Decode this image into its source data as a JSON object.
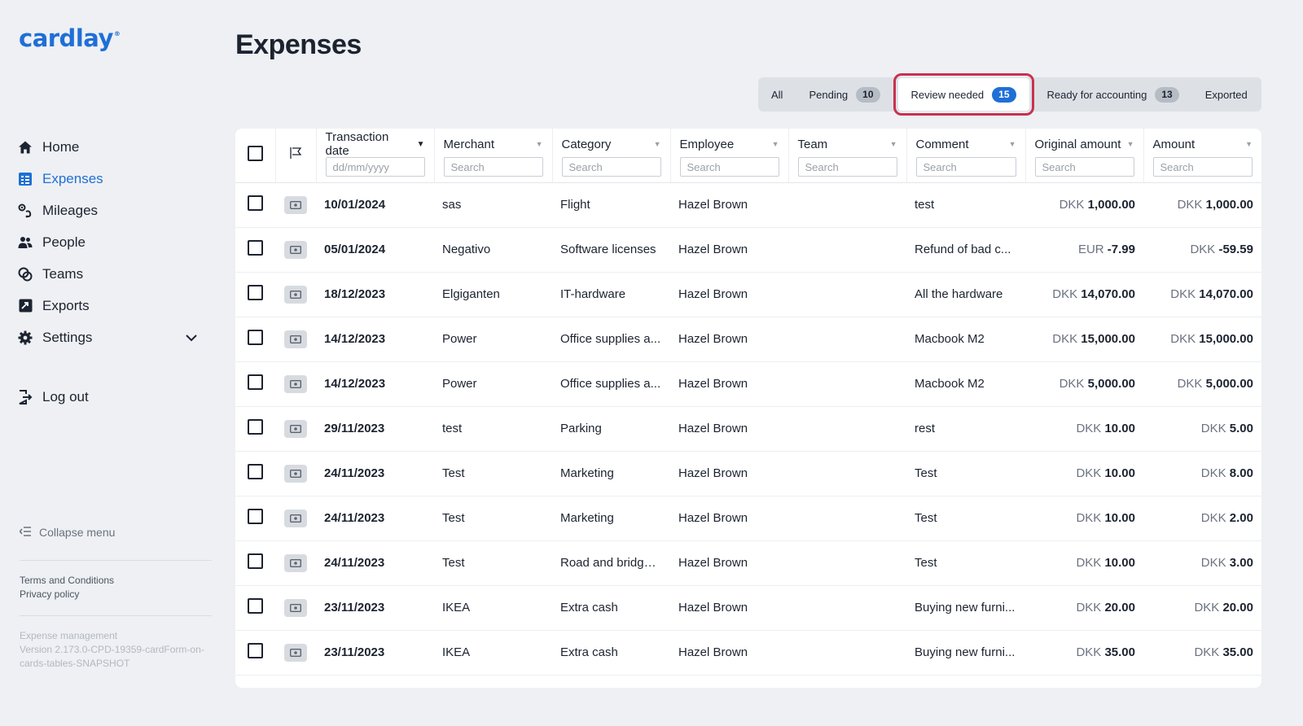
{
  "brand": {
    "name": "cardlay",
    "mark": "®"
  },
  "sidebar": {
    "items": [
      {
        "label": "Home",
        "icon": "home-icon",
        "active": false
      },
      {
        "label": "Expenses",
        "icon": "expenses-icon",
        "active": true
      },
      {
        "label": "Mileages",
        "icon": "mileages-icon",
        "active": false
      },
      {
        "label": "People",
        "icon": "people-icon",
        "active": false
      },
      {
        "label": "Teams",
        "icon": "teams-icon",
        "active": false
      },
      {
        "label": "Exports",
        "icon": "exports-icon",
        "active": false
      },
      {
        "label": "Settings",
        "icon": "gear-icon",
        "active": false
      }
    ],
    "logout": "Log out",
    "collapse": "Collapse menu",
    "terms": "Terms and Conditions",
    "privacy": "Privacy policy",
    "version_line1": "Expense management",
    "version_line2": "Version 2.173.0-CPD-19359-cardForm-on-cards-tables-SNAPSHOT"
  },
  "page": {
    "title": "Expenses"
  },
  "tabs": [
    {
      "label": "All",
      "count": null,
      "active": false
    },
    {
      "label": "Pending",
      "count": "10",
      "active": false
    },
    {
      "label": "Review needed",
      "count": "15",
      "active": true
    },
    {
      "label": "Ready for accounting",
      "count": "13",
      "active": false
    },
    {
      "label": "Exported",
      "count": null,
      "active": false
    }
  ],
  "table": {
    "columns": [
      {
        "label": "Transaction date",
        "placeholder": "dd/mm/yyyy",
        "sorted": true
      },
      {
        "label": "Merchant",
        "placeholder": "Search"
      },
      {
        "label": "Category",
        "placeholder": "Search"
      },
      {
        "label": "Employee",
        "placeholder": "Search"
      },
      {
        "label": "Team",
        "placeholder": "Search"
      },
      {
        "label": "Comment",
        "placeholder": "Search"
      },
      {
        "label": "Original amount",
        "placeholder": "Search"
      },
      {
        "label": "Amount",
        "placeholder": "Search"
      }
    ],
    "rows": [
      {
        "date": "10/01/2024",
        "merchant": "sas",
        "category": "Flight",
        "employee": "Hazel Brown",
        "team": "",
        "comment": "test",
        "orig_cur": "DKK",
        "orig_amt": "1,000.00",
        "cur": "DKK",
        "amt": "1,000.00"
      },
      {
        "date": "05/01/2024",
        "merchant": "Negativo",
        "category": "Software licenses",
        "employee": "Hazel Brown",
        "team": "",
        "comment": "Refund of bad c...",
        "orig_cur": "EUR",
        "orig_amt": "-7.99",
        "cur": "DKK",
        "amt": "-59.59"
      },
      {
        "date": "18/12/2023",
        "merchant": "Elgiganten",
        "category": "IT-hardware",
        "employee": "Hazel Brown",
        "team": "",
        "comment": "All the hardware",
        "orig_cur": "DKK",
        "orig_amt": "14,070.00",
        "cur": "DKK",
        "amt": "14,070.00"
      },
      {
        "date": "14/12/2023",
        "merchant": "Power",
        "category": "Office supplies a...",
        "employee": "Hazel Brown",
        "team": "",
        "comment": "Macbook M2",
        "orig_cur": "DKK",
        "orig_amt": "15,000.00",
        "cur": "DKK",
        "amt": "15,000.00"
      },
      {
        "date": "14/12/2023",
        "merchant": "Power",
        "category": "Office supplies a...",
        "employee": "Hazel Brown",
        "team": "",
        "comment": "Macbook M2",
        "orig_cur": "DKK",
        "orig_amt": "5,000.00",
        "cur": "DKK",
        "amt": "5,000.00"
      },
      {
        "date": "29/11/2023",
        "merchant": "test",
        "category": "Parking",
        "employee": "Hazel Brown",
        "team": "",
        "comment": "rest",
        "orig_cur": "DKK",
        "orig_amt": "10.00",
        "cur": "DKK",
        "amt": "5.00"
      },
      {
        "date": "24/11/2023",
        "merchant": "Test",
        "category": "Marketing",
        "employee": "Hazel Brown",
        "team": "",
        "comment": "Test",
        "orig_cur": "DKK",
        "orig_amt": "10.00",
        "cur": "DKK",
        "amt": "8.00"
      },
      {
        "date": "24/11/2023",
        "merchant": "Test",
        "category": "Marketing",
        "employee": "Hazel Brown",
        "team": "",
        "comment": "Test",
        "orig_cur": "DKK",
        "orig_amt": "10.00",
        "cur": "DKK",
        "amt": "2.00"
      },
      {
        "date": "24/11/2023",
        "merchant": "Test",
        "category": "Road and bridge ...",
        "employee": "Hazel Brown",
        "team": "",
        "comment": "Test",
        "orig_cur": "DKK",
        "orig_amt": "10.00",
        "cur": "DKK",
        "amt": "3.00"
      },
      {
        "date": "23/11/2023",
        "merchant": "IKEA",
        "category": "Extra cash",
        "employee": "Hazel Brown",
        "team": "",
        "comment": "Buying new furni...",
        "orig_cur": "DKK",
        "orig_amt": "20.00",
        "cur": "DKK",
        "amt": "20.00"
      },
      {
        "date": "23/11/2023",
        "merchant": "IKEA",
        "category": "Extra cash",
        "employee": "Hazel Brown",
        "team": "",
        "comment": "Buying new furni...",
        "orig_cur": "DKK",
        "orig_amt": "35.00",
        "cur": "DKK",
        "amt": "35.00"
      }
    ]
  },
  "colors": {
    "accent": "#1f6fd6",
    "highlight": "#c8314f",
    "background": "#eef0f3"
  }
}
